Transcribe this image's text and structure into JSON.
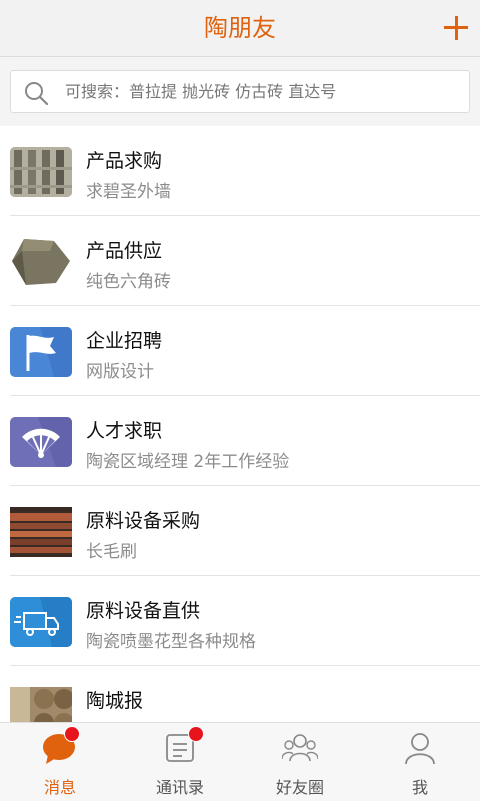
{
  "header": {
    "title": "陶朋友",
    "add_icon": "plus-icon"
  },
  "search": {
    "placeholder": "可搜索：普拉提 抛光砖 仿古砖 直达号",
    "icon": "search-icon"
  },
  "list": [
    {
      "title": "产品求购",
      "subtitle": "求碧圣外墙"
    },
    {
      "title": "产品供应",
      "subtitle": "纯色六角砖"
    },
    {
      "title": "企业招聘",
      "subtitle": "网版设计"
    },
    {
      "title": "人才求职",
      "subtitle": "陶瓷区域经理 2年工作经验"
    },
    {
      "title": "原料设备采购",
      "subtitle": "长毛刷"
    },
    {
      "title": "原料设备直供",
      "subtitle": "陶瓷喷墨花型各种规格"
    },
    {
      "title": "陶城报",
      "subtitle": ""
    }
  ],
  "tabs": [
    {
      "label": "消息",
      "icon": "chat-bubble-icon",
      "active": true,
      "badge": true
    },
    {
      "label": "通讯录",
      "icon": "contacts-icon",
      "active": false,
      "badge": true
    },
    {
      "label": "好友圈",
      "icon": "friends-icon",
      "active": false,
      "badge": false
    },
    {
      "label": "我",
      "icon": "user-icon",
      "active": false,
      "badge": false
    }
  ],
  "colors": {
    "accent": "#e0620f",
    "badge": "#e8141b",
    "flag_bg": "#4a86d6",
    "fan_bg": "#6f6fb8",
    "truck_bg": "#2f8ed8"
  }
}
